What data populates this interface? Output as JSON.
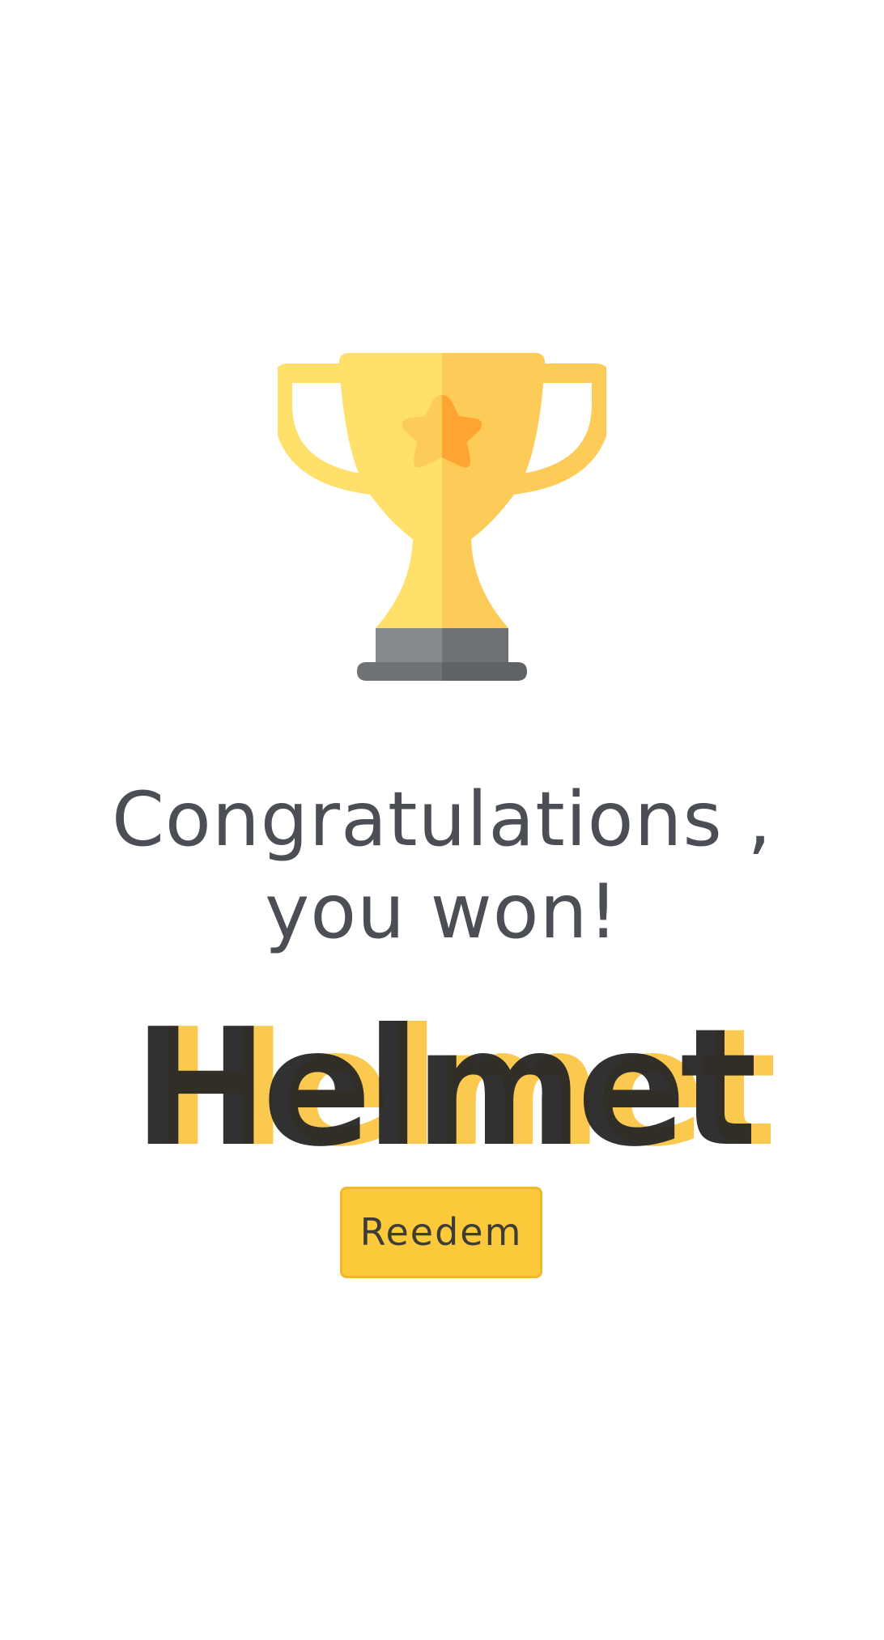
{
  "congrats": {
    "title": "Congratulations , you won!"
  },
  "prize": {
    "name": "Helmet"
  },
  "actions": {
    "redeem_label": "Reedem"
  },
  "icons": {
    "trophy": "trophy-icon",
    "star": "star-icon"
  },
  "colors": {
    "accent": "#fcc93a",
    "trophy_light": "#fee06b",
    "trophy_dark": "#fccb58",
    "star_dark": "#ffa433",
    "base_light": "#858a8e",
    "base_dark": "#6e7275",
    "title_text": "#4b4f55"
  }
}
